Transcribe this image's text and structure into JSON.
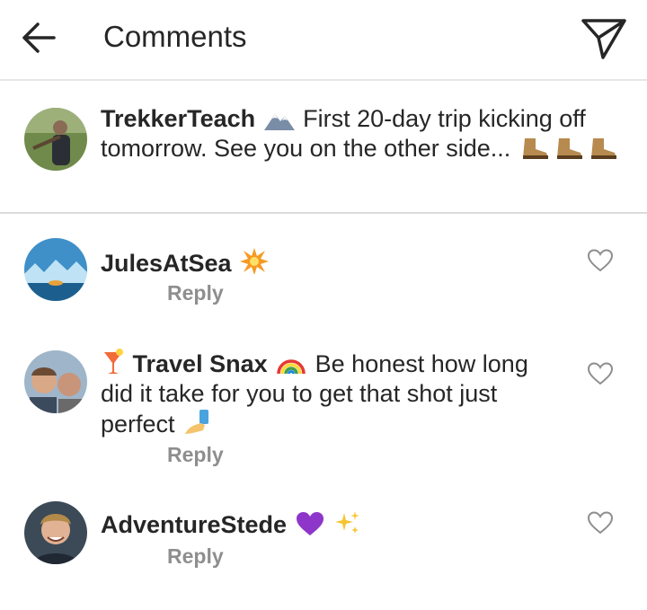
{
  "header": {
    "title": "Comments",
    "back_icon": "arrow-left-icon",
    "send_icon": "paper-plane-icon"
  },
  "caption": {
    "username": "TrekkerTeach",
    "username_emoji": "mountain-icon",
    "text_line1": "First 20-day trip kicking off",
    "text_line2": "tomorrow. See you on the other side...",
    "trailing_emojis": [
      "boot-icon",
      "boot-icon",
      "boot-icon"
    ]
  },
  "comments": [
    {
      "username": "JulesAtSea",
      "username_emoji": "collision-icon",
      "text": "",
      "reply_label": "Reply",
      "like_icon": "heart-outline-icon"
    },
    {
      "prefix_emoji": "tropical-drink-icon",
      "username": "Travel Snax",
      "username_emoji": "rainbow-icon",
      "text_line1": "Be honest how long",
      "text_line2": "did it take for you to get that shot just",
      "text_line3": "perfect",
      "trailing_emoji": "selfie-icon",
      "reply_label": "Reply",
      "like_icon": "heart-outline-icon"
    },
    {
      "username": "AdventureStede",
      "username_emojis": [
        "purple-heart-icon",
        "sparkles-icon"
      ],
      "text": "",
      "reply_label": "Reply",
      "like_icon": "heart-outline-icon"
    }
  ],
  "colors": {
    "text": "#262626",
    "muted": "#8e8e8e",
    "divider": "#dbdbdb"
  }
}
